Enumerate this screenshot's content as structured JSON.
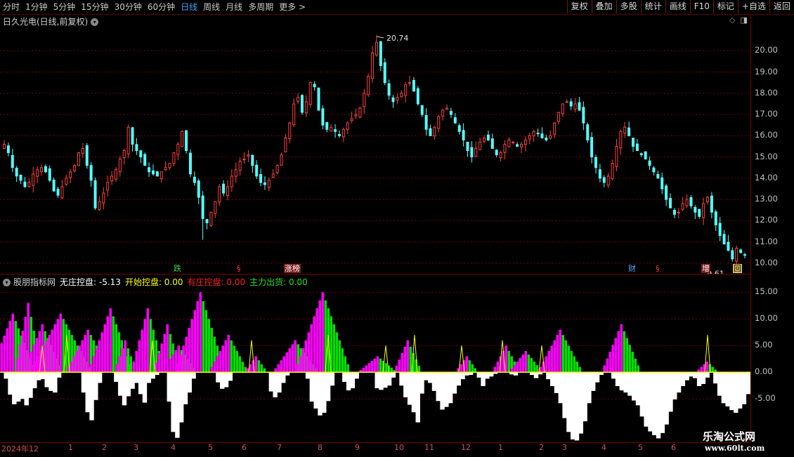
{
  "toolbar": {
    "periods": [
      "分时",
      "1分钟",
      "5分钟",
      "15分钟",
      "30分钟",
      "60分钟",
      "日线",
      "周线",
      "月线",
      "多周期",
      "更多 >"
    ],
    "active": "日线",
    "right_buttons": [
      "复权",
      "叠加",
      "多股",
      "统计",
      "画线",
      "F10",
      "标记",
      "+自选",
      "返回"
    ]
  },
  "main_chart": {
    "title": "日久光电(日线,前复权)",
    "high_label": "20.74",
    "low_label": "9.61",
    "y_ticks": [
      "20.00",
      "19.00",
      "18.00",
      "17.00",
      "16.00",
      "15.00",
      "14.00",
      "13.00",
      "12.00",
      "11.00",
      "10.00"
    ],
    "events": [
      {
        "text": "跌",
        "color": "#3cd23c"
      },
      {
        "text": "§",
        "color": "#ff3030"
      },
      {
        "text": "涨榜",
        "color": "#ffffff",
        "bg": "#7a1a1a"
      },
      {
        "text": "财",
        "color": "#4aa8ff"
      },
      {
        "text": "§",
        "color": "#ff3030"
      },
      {
        "text": "增",
        "color": "#ffffff",
        "bg": "#7a1a1a"
      },
      {
        "text": "回",
        "color": "#000000",
        "bg": "#e0c060"
      }
    ]
  },
  "indicator": {
    "name": "股朋指标网",
    "values": [
      {
        "label": "无庄控盘:",
        "value": "-5.13",
        "color": "#ffffff"
      },
      {
        "label": "开始控盘:",
        "value": "0.00",
        "color": "#ffff00"
      },
      {
        "label": "有庄控盘:",
        "value": "0.00",
        "color": "#ff2020"
      },
      {
        "label": "主力出货:",
        "value": "0.00",
        "color": "#20e020"
      }
    ],
    "y_ticks": [
      "15.00",
      "10.00",
      "5.00",
      "0.00",
      "-5.00"
    ]
  },
  "time_axis": {
    "year_label": "2024年12",
    "months": [
      "1",
      "2",
      "3",
      "4",
      "5",
      "6",
      "7",
      "8",
      "9",
      "10",
      "11",
      "12",
      "1",
      "2",
      "3",
      "4",
      "5",
      "6"
    ]
  },
  "watermark": {
    "line1": "乐淘公式网",
    "line2": "www.60lt.com"
  },
  "colors": {
    "up": "#ff4040",
    "down": "#54ffff",
    "magenta": "#ff00ff",
    "green": "#00e000",
    "yellow": "#ffff00",
    "grid": "#7a0000"
  },
  "chart_data": {
    "type": "candlestick",
    "series_close": [
      15.6,
      15.2,
      14.5,
      14.1,
      13.9,
      13.6,
      13.8,
      14.2,
      14.4,
      14.5,
      14.3,
      13.9,
      13.4,
      13.2,
      13.6,
      14.0,
      14.3,
      14.6,
      15.2,
      15.4,
      14.6,
      13.9,
      12.6,
      12.9,
      13.3,
      13.8,
      14.1,
      14.4,
      14.9,
      15.3,
      16.4,
      15.6,
      15.3,
      15.0,
      14.6,
      14.3,
      14.2,
      14.1,
      14.3,
      14.5,
      14.7,
      15.2,
      15.6,
      16.2,
      15.3,
      14.2,
      13.8,
      13.1,
      12.1,
      11.9,
      12.4,
      12.9,
      13.6,
      13.3,
      13.6,
      14.1,
      14.4,
      14.8,
      14.9,
      15.1,
      14.6,
      14.1,
      13.8,
      13.7,
      13.9,
      14.2,
      14.6,
      15.1,
      15.9,
      16.6,
      17.5,
      17.8,
      17.1,
      17.6,
      18.5,
      18.3,
      17.2,
      16.5,
      16.3,
      16.4,
      16.2,
      16.0,
      16.3,
      16.6,
      16.8,
      17.0,
      17.3,
      18.0,
      18.8,
      19.9,
      20.4,
      19.3,
      18.5,
      17.9,
      17.6,
      17.8,
      18.0,
      18.4,
      18.5,
      18.1,
      17.5,
      17.0,
      16.3,
      16.0,
      16.4,
      16.9,
      17.2,
      17.3,
      17.0,
      16.6,
      16.2,
      15.8,
      15.3,
      15.0,
      15.4,
      15.7,
      15.9,
      15.8,
      15.4,
      15.1,
      15.2,
      15.6,
      15.8,
      15.7,
      15.5,
      15.6,
      15.8,
      16.0,
      16.2,
      16.1,
      15.9,
      15.8,
      16.0,
      16.6,
      17.1,
      17.5,
      17.6,
      17.4,
      17.5,
      17.2,
      16.6,
      15.8,
      15.0,
      14.5,
      14.0,
      13.8,
      14.1,
      14.7,
      15.5,
      16.2,
      16.4,
      16.0,
      15.5,
      15.3,
      15.1,
      14.9,
      14.6,
      14.3,
      14.0,
      13.5,
      13.0,
      12.6,
      12.3,
      12.4,
      12.8,
      13.0,
      12.7,
      12.4,
      12.2,
      12.8,
      13.1,
      12.4,
      11.8,
      11.3,
      10.9,
      10.6,
      10.2,
      10.7,
      10.5,
      10.4
    ],
    "high": 20.74,
    "low": 9.61,
    "ylim": [
      9.5,
      21.2
    ],
    "indicator_series": {
      "white": [
        -1.2,
        -4.2,
        -6,
        -5.5,
        -5,
        -6.2,
        -4.8,
        -3,
        -1.5,
        -1.3,
        -2.8,
        -3.5,
        -3.8,
        -1,
        0,
        0,
        0,
        0,
        0,
        -3.8,
        -7.5,
        -9,
        -5.2,
        -2,
        0,
        0,
        0,
        -1.8,
        -4.4,
        -6.2,
        -4.5,
        -3.1,
        -2,
        -4.1,
        -5.7,
        -2,
        -1.2,
        -0.5,
        0,
        0,
        -5.5,
        -11.2,
        -12.3,
        -9.4,
        -6,
        -3.8,
        -1.2,
        0,
        0,
        0,
        0,
        0,
        -1.9,
        -3.1,
        -2.8,
        -1.6,
        0,
        0,
        0,
        0,
        0,
        0,
        0,
        0,
        0,
        -3.6,
        -4.7,
        -3.8,
        -2,
        -0.6,
        0,
        0,
        0,
        0,
        -1.2,
        -5.5,
        -6.8,
        -8.1,
        -7.6,
        -5.4,
        -2.5,
        0,
        0,
        -1.8,
        -3.4,
        -3,
        -1.2,
        0,
        0,
        0,
        0,
        -3,
        -3.3,
        -2.9,
        -2.5,
        -1,
        0,
        -2.5,
        -4.7,
        -6.1,
        -7.5,
        -9.4,
        -4,
        -1.5,
        -2,
        -3.5,
        -5.4,
        -7,
        -6.5,
        -5.8,
        -4,
        -2.5,
        -1.3,
        -0.6,
        -0.5,
        0,
        -1,
        -2.6,
        -1.2,
        -0.8,
        -0.3,
        0,
        0,
        0,
        -0.4,
        -0.6,
        0,
        0,
        0,
        -0.5,
        -1.1,
        -0.4,
        0,
        -1.3,
        -2.6,
        -3.9,
        -5.8,
        -8.6,
        -11.2,
        -12.6,
        -12.8,
        -11.5,
        -9.2,
        -5.8,
        -3.5,
        -1.9,
        -0.5,
        0,
        0,
        -1.2,
        -2.6,
        -3.4,
        -3.8,
        -4.4,
        -5.3,
        -6.2,
        -8.3,
        -10.2,
        -11.1,
        -11.8,
        -12.4,
        -11.4,
        -9.8,
        -7.4,
        -5.1,
        -3.8,
        -2.6,
        -1.5,
        -0.8,
        -1.1,
        -2.6,
        -2.2,
        -1,
        0,
        -2.1,
        -4.4,
        -5.8,
        -6.4,
        -7.1,
        -7.6,
        -6.8,
        -6,
        -4.1
      ],
      "magenta": [
        0,
        0,
        0,
        0,
        0,
        0,
        0,
        0,
        0,
        0,
        0,
        0,
        0,
        0,
        0,
        0,
        0,
        0,
        0,
        0,
        0,
        0,
        0,
        0,
        0,
        0,
        0,
        0,
        1.5,
        1,
        0,
        0,
        0,
        0,
        0,
        0,
        0,
        0,
        0,
        0,
        0,
        0,
        0,
        0,
        0,
        0,
        0,
        0,
        0,
        0,
        0,
        0,
        0,
        0,
        0,
        0,
        0,
        0,
        0,
        0,
        0,
        0,
        0,
        0,
        3,
        4.5,
        6,
        7.5,
        6.8,
        6.2,
        5.5,
        4.8,
        4.2,
        0,
        0,
        0,
        0,
        0,
        0,
        0,
        0,
        0,
        0,
        0,
        0,
        0,
        0,
        0,
        0,
        0,
        0,
        0,
        0,
        0,
        0,
        0,
        0,
        0,
        0,
        0,
        0,
        0,
        0,
        0,
        0,
        0,
        0,
        0,
        0,
        0,
        0,
        0,
        0,
        0,
        0,
        0,
        0,
        0,
        0,
        0,
        0,
        0,
        0,
        0,
        0,
        0,
        0,
        0,
        0,
        0,
        0,
        0,
        0,
        0,
        0,
        0,
        0,
        0,
        0,
        0,
        0,
        0,
        0,
        0,
        0,
        0,
        0,
        0,
        0,
        0,
        0,
        0,
        0,
        0,
        0,
        0,
        0,
        0,
        0,
        0,
        0,
        0,
        0,
        0,
        0,
        0,
        0,
        0,
        0,
        0,
        0,
        0,
        0,
        0,
        0,
        0,
        0,
        0,
        0,
        0,
        0,
        0,
        0,
        0,
        0,
        0,
        0,
        0,
        0,
        0,
        0
      ]
    },
    "ind_ylim": [
      -13,
      16.5
    ]
  }
}
